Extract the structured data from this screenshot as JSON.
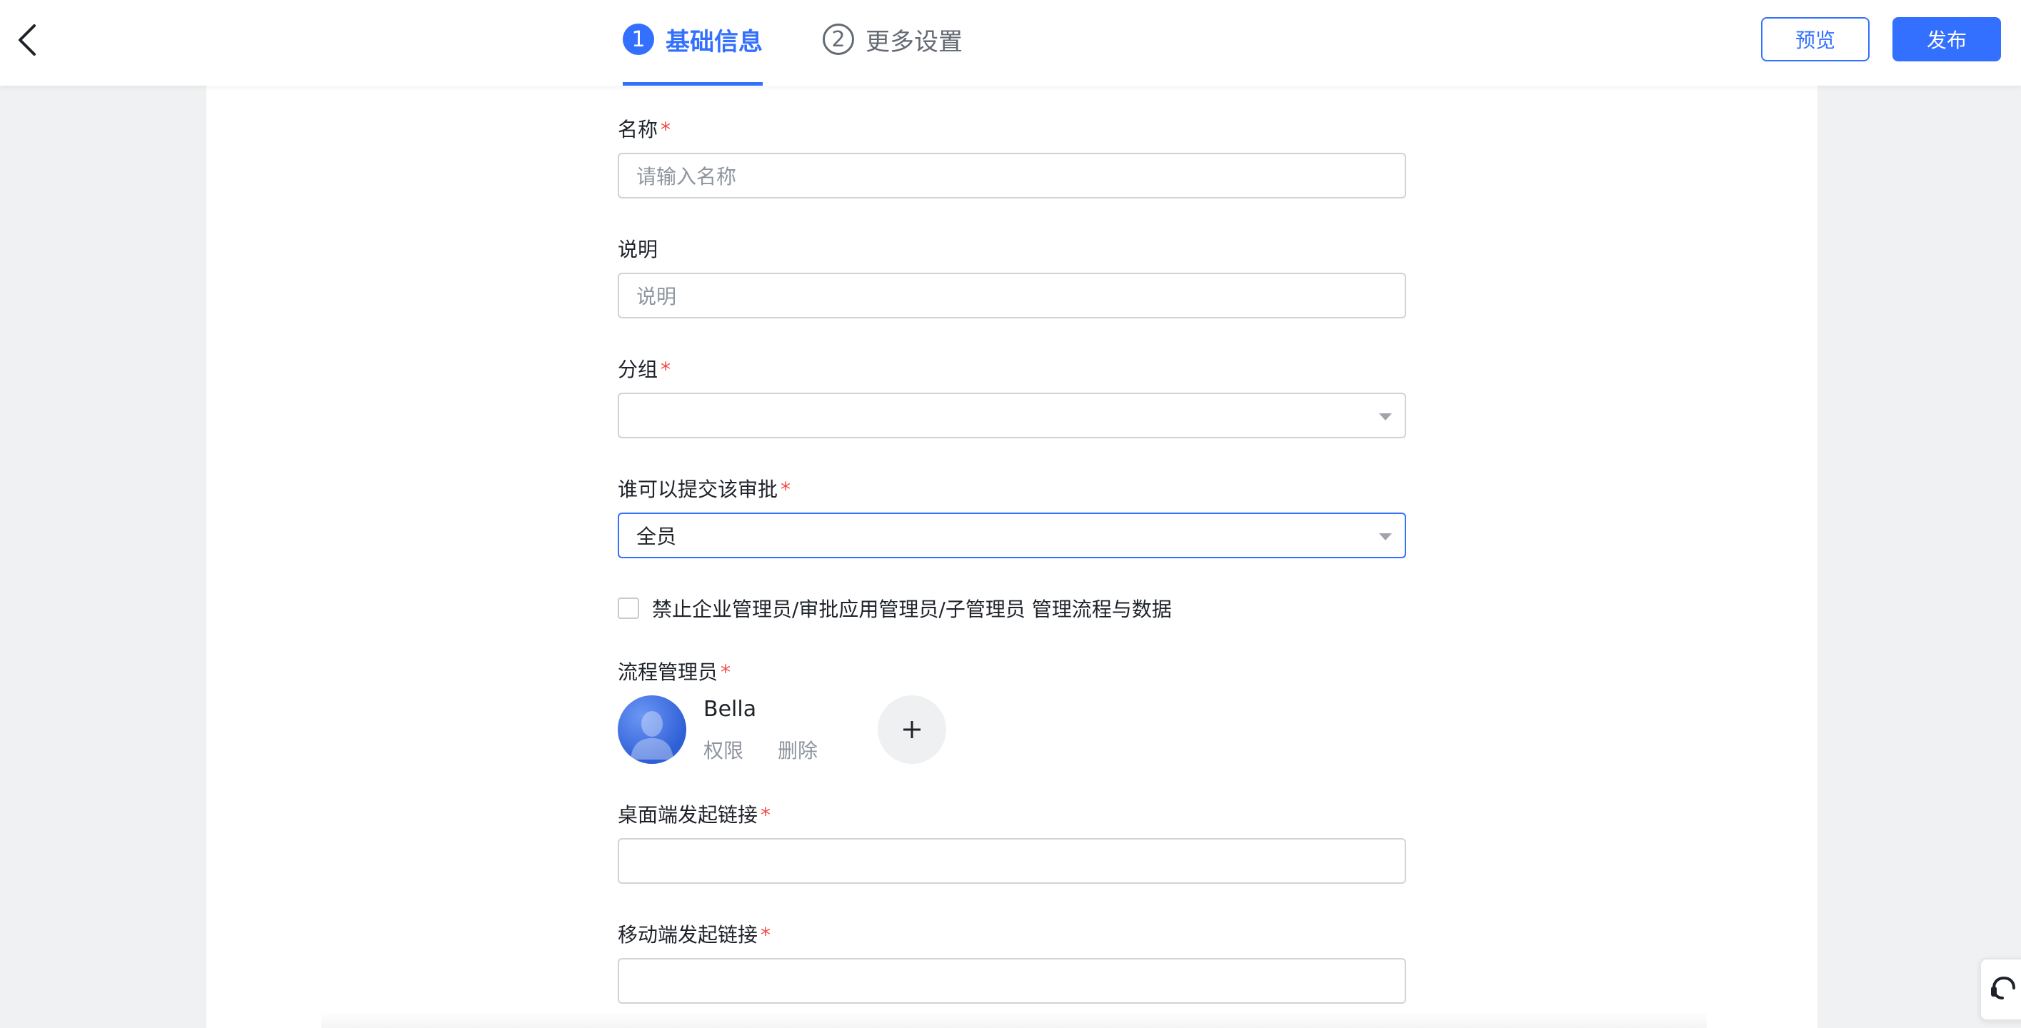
{
  "header": {
    "steps": [
      {
        "number": "1",
        "label": "基础信息"
      },
      {
        "number": "2",
        "label": "更多设置"
      }
    ],
    "preview_label": "预览",
    "publish_label": "发布"
  },
  "form": {
    "name": {
      "label": "名称",
      "required_mark": "*",
      "placeholder": "请输入名称",
      "value": ""
    },
    "description": {
      "label": "说明",
      "placeholder": "说明",
      "value": ""
    },
    "group": {
      "label": "分组",
      "required_mark": "*",
      "value": ""
    },
    "submitter": {
      "label": "谁可以提交该审批",
      "required_mark": "*",
      "value": "全员"
    },
    "restrict_checkbox": {
      "label": "禁止企业管理员/审批应用管理员/子管理员 管理流程与数据",
      "checked": false
    },
    "process_admin": {
      "label": "流程管理员",
      "required_mark": "*",
      "admins": [
        {
          "name": "Bella",
          "permission_label": "权限",
          "delete_label": "删除"
        }
      ],
      "add_icon": "plus-icon"
    },
    "desktop_link": {
      "label": "桌面端发起链接",
      "required_mark": "*",
      "value": ""
    },
    "mobile_link": {
      "label": "移动端发起链接",
      "required_mark": "*",
      "value": ""
    }
  },
  "icons": {
    "back": "chevron-left-icon",
    "caret": "caret-down-icon",
    "help": "headset-icon"
  },
  "colors": {
    "accent": "#3370ff",
    "required": "#f54a45",
    "page_bg": "#f0f1f2"
  }
}
